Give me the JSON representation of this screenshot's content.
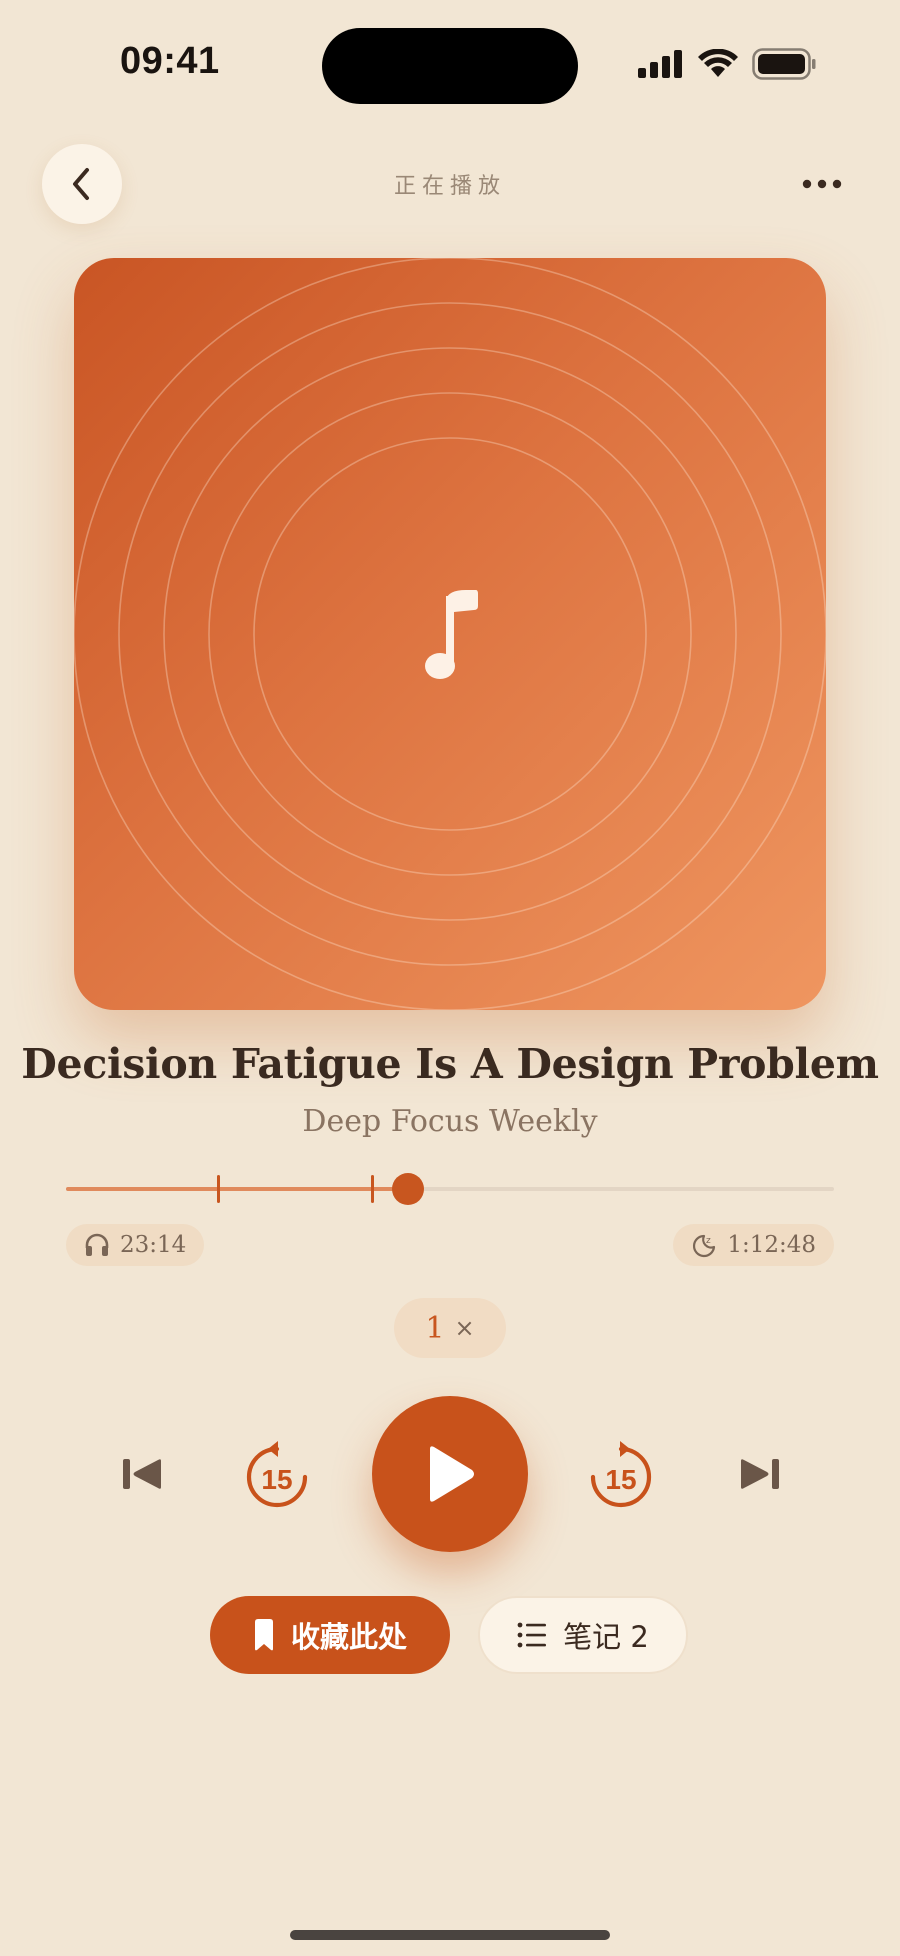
{
  "status_bar": {
    "time": "09:41"
  },
  "header": {
    "title": "正在播放"
  },
  "track": {
    "title": "Decision Fatigue Is A Design Problem",
    "show": "Deep Focus Weekly"
  },
  "progress": {
    "fraction": 0.445,
    "chapter_marks": [
      0.197,
      0.397
    ],
    "elapsed": "23:14",
    "remaining": "1:12:48"
  },
  "speed": {
    "value": "1",
    "suffix": "×"
  },
  "controls": {
    "skip_back_seconds": "15",
    "skip_forward_seconds": "15"
  },
  "actions": {
    "bookmark_label": "收藏此处",
    "notes_label": "笔记 2"
  },
  "colors": {
    "accent": "#c8521b",
    "background": "#f2e6d4",
    "artwork_start": "#c95524",
    "artwork_end": "#ef9660"
  }
}
